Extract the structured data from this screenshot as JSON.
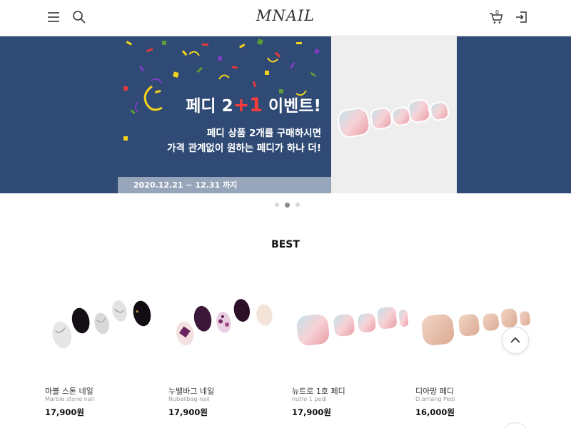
{
  "header": {
    "logo": "MNAIL",
    "cart_count": "0",
    "icons": [
      "menu-icon",
      "search-icon",
      "cart-icon",
      "login-icon"
    ]
  },
  "banner": {
    "title_prefix": "페디 2",
    "title_plus": "+1",
    "title_suffix": " 이벤트!",
    "line1": "페디 상품 2개를 구매하시면",
    "line2": "가격 관계없이 원하는 페디가 하나 더!",
    "date": "2020.12.21 ~ 12.31 까지",
    "colors": {
      "background": "#2f4a74",
      "accent": "#ff3b3b"
    }
  },
  "slider": {
    "count": 3,
    "active": 1
  },
  "section": {
    "title": "BEST"
  },
  "products": [
    {
      "name": "마블 스톤 네일",
      "eng": "Marble stone nail",
      "price": "17,900원"
    },
    {
      "name": "누벨바그 네일",
      "eng": "Nubellbag nail",
      "price": "17,900원"
    },
    {
      "name": "뉴트로 1호 페디",
      "eng": "nutro 1 pedi",
      "price": "17,900원"
    },
    {
      "name": "디아망 페디",
      "eng": "D.amang Pedi",
      "price": "16,000원"
    }
  ]
}
